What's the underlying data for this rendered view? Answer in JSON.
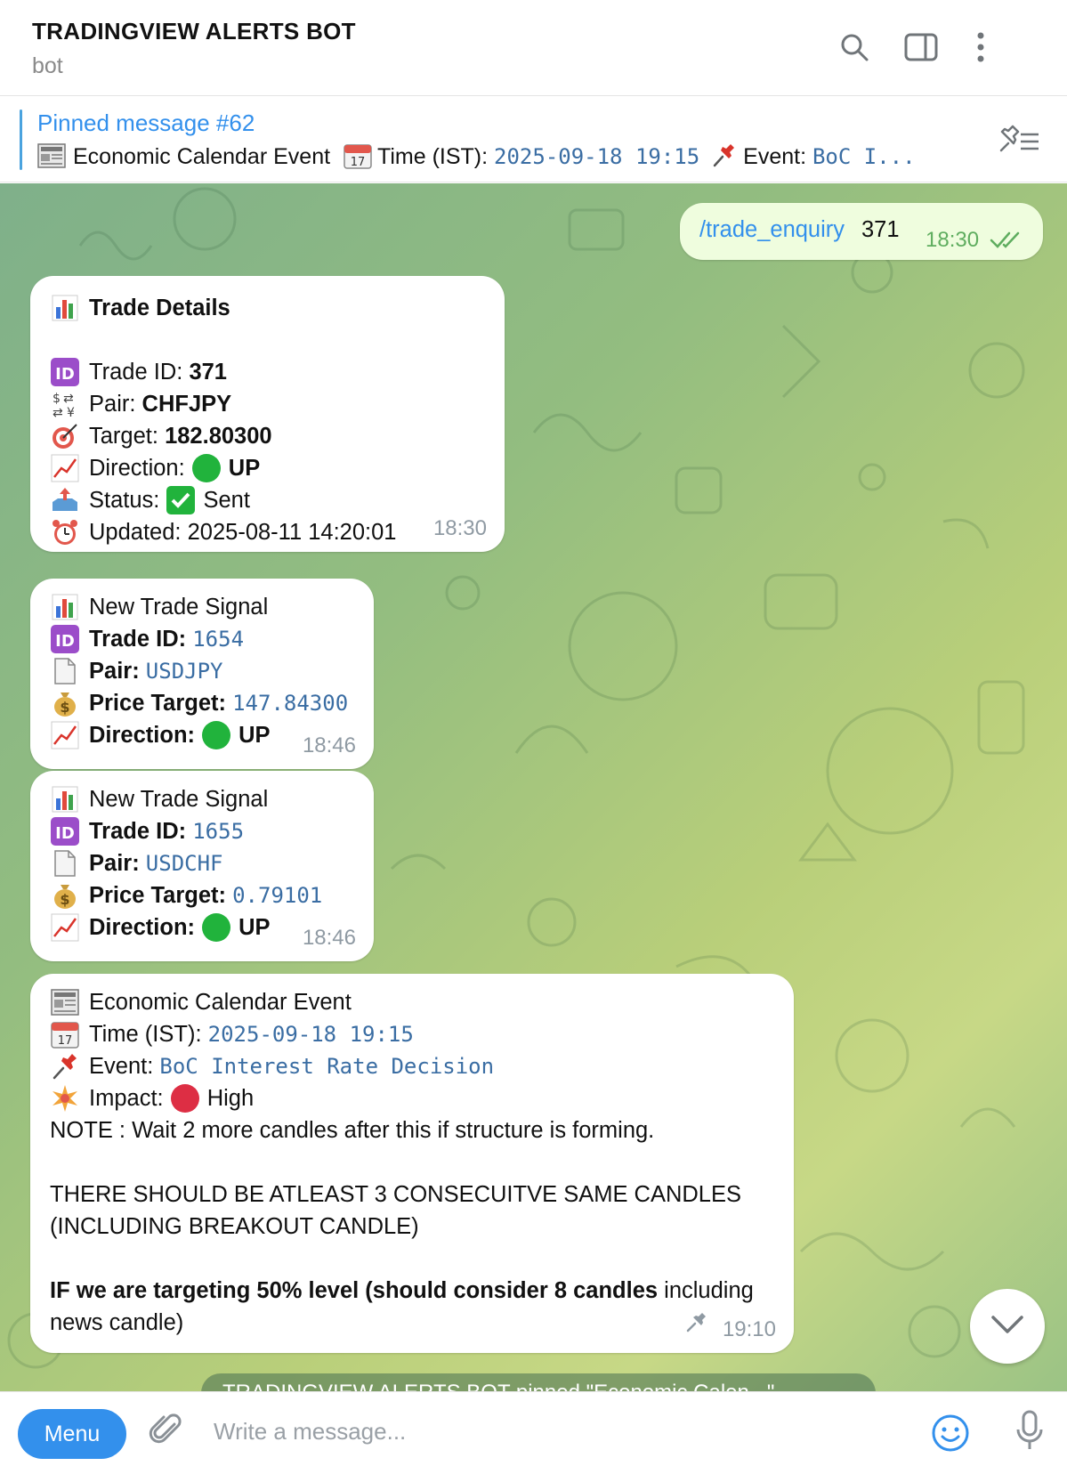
{
  "header": {
    "title": "TRADINGVIEW ALERTS BOT",
    "subtitle": "bot",
    "icons": [
      "search-icon",
      "sidebar-toggle-icon",
      "more-vert-icon"
    ]
  },
  "pinned": {
    "title": "Pinned message #62",
    "text_part1": "Economic Calendar Event",
    "text_part2": "Time (IST):",
    "time_value": "2025-09-18 19:15",
    "text_part3": "Event:",
    "event_value": "BoC I...",
    "icon": "pinned-list-icon"
  },
  "outgoing": {
    "command": "/trade_enquiry",
    "argument": "371",
    "time": "18:30"
  },
  "trade_details": {
    "title": "Trade Details",
    "trade_id_label": "Trade ID:",
    "trade_id": "371",
    "pair_label": "Pair:",
    "pair": "CHFJPY",
    "target_label": "Target:",
    "target": "182.80300",
    "direction_label": "Direction:",
    "direction": "UP",
    "status_label": "Status:",
    "status": "Sent",
    "updated_label": "Updated:",
    "updated": "2025-08-11 14:20:01",
    "time": "18:30"
  },
  "signal1": {
    "title": "New Trade Signal",
    "trade_id_label": "Trade ID:",
    "trade_id": "1654",
    "pair_label": "Pair:",
    "pair": "USDJPY",
    "price_label": "Price Target:",
    "price": "147.84300",
    "direction_label": "Direction:",
    "direction": "UP",
    "time": "18:46"
  },
  "signal2": {
    "title": "New Trade Signal",
    "trade_id_label": "Trade ID:",
    "trade_id": "1655",
    "pair_label": "Pair:",
    "pair": "USDCHF",
    "price_label": "Price Target:",
    "price": "0.79101",
    "direction_label": "Direction:",
    "direction": "UP",
    "time": "18:46"
  },
  "econ": {
    "title": "Economic Calendar Event",
    "time_label": "Time (IST):",
    "time_value": "2025-09-18 19:15",
    "event_label": "Event:",
    "event_value": "BoC Interest Rate Decision",
    "impact_label": "Impact:",
    "impact_value": "High",
    "note": "NOTE : Wait 2 more candles after this if structure is forming.",
    "rule1": "THERE SHOULD BE ATLEAST 3 CONSECUITVE SAME CANDLES",
    "rule2": "(INCLUDING BREAKOUT CANDLE)",
    "target_bold": "IF we are targeting 50% level (should consider 8 candles",
    "target_normal": " including",
    "target_line2": "news candle)",
    "time": "19:10"
  },
  "service_message": "TRADINGVIEW ALERTS BOT pinned \"Economic Calen...\"",
  "composer": {
    "menu_label": "Menu",
    "placeholder": "Write a message..."
  },
  "colors": {
    "accent": "#3390ec",
    "outgoing_bg": "#effdde",
    "check_green": "#5fad5f"
  }
}
